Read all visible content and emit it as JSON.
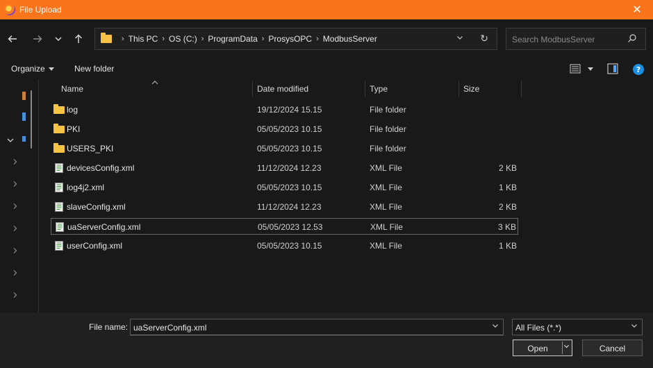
{
  "window": {
    "title": "File Upload",
    "close_glyph": "✕",
    "accent": "#f9741b"
  },
  "nav": {
    "back_glyph": "🡐",
    "forward_glyph": "🡒",
    "recent_glyph": "⌄",
    "up_glyph": "🡑",
    "breadcrumb": [
      "This PC",
      "OS (C:)",
      "ProgramData",
      "ProsysOPC",
      "ModbusServer"
    ],
    "breadcrumb_sep": "›",
    "dropdown_glyph": "⌄",
    "refresh_glyph": "↻",
    "search_placeholder": "Search ModbusServer"
  },
  "toolbar": {
    "organize_label": "Organize",
    "new_folder_label": "New folder",
    "help_glyph": "?"
  },
  "columns": {
    "name": "Name",
    "date": "Date modified",
    "type": "Type",
    "size": "Size"
  },
  "files": [
    {
      "name": "log",
      "date": "19/12/2024 15.15",
      "type": "File folder",
      "size": "",
      "icon": "folder-icon"
    },
    {
      "name": "PKI",
      "date": "05/05/2023 10.15",
      "type": "File folder",
      "size": "",
      "icon": "folder-icon"
    },
    {
      "name": "USERS_PKI",
      "date": "05/05/2023 10.15",
      "type": "File folder",
      "size": "",
      "icon": "folder-icon"
    },
    {
      "name": "devicesConfig.xml",
      "date": "11/12/2024 12.23",
      "type": "XML File",
      "size": "2 KB",
      "icon": "xml-file-icon"
    },
    {
      "name": "log4j2.xml",
      "date": "05/05/2023 10.15",
      "type": "XML File",
      "size": "1 KB",
      "icon": "xml-file-icon"
    },
    {
      "name": "slaveConfig.xml",
      "date": "11/12/2024 12.23",
      "type": "XML File",
      "size": "2 KB",
      "icon": "xml-file-icon"
    },
    {
      "name": "uaServerConfig.xml",
      "date": "05/05/2023 12.53",
      "type": "XML File",
      "size": "3 KB",
      "icon": "xml-file-icon",
      "selected": true
    },
    {
      "name": "userConfig.xml",
      "date": "05/05/2023 10.15",
      "type": "XML File",
      "size": "1 KB",
      "icon": "xml-file-icon"
    }
  ],
  "bottom": {
    "file_name_label": "File name:",
    "file_name_value": "uaServerConfig.xml",
    "filter_value": "All Files (*.*)",
    "open_label": "Open",
    "cancel_label": "Cancel"
  }
}
